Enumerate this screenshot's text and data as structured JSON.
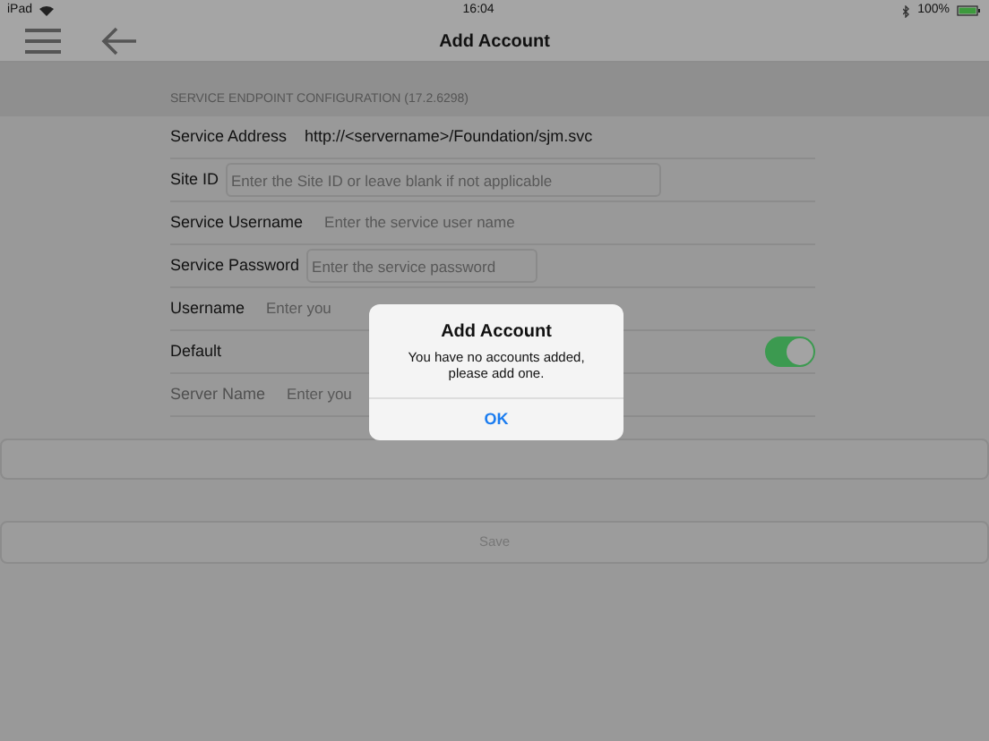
{
  "status_bar": {
    "device": "iPad",
    "time": "16:04",
    "battery": "100%"
  },
  "nav_bar": {
    "title": "Add Account"
  },
  "form": {
    "section_header": "SERVICE ENDPOINT CONFIGURATION (17.2.6298)",
    "rows": [
      {
        "kind": "value",
        "label": "Service Address",
        "value": "http://<servername>/Foundation/sjm.svc",
        "disabled": false
      },
      {
        "kind": "boxed",
        "label": "Site ID",
        "placeholder": "Enter the Site ID or leave blank if not applicable",
        "disabled": false
      },
      {
        "kind": "plain",
        "label": "Service Username",
        "placeholder": "Enter the service user name",
        "disabled": false
      },
      {
        "kind": "boxed",
        "label": "Service Password",
        "placeholder": "Enter the service password",
        "disabled": false
      },
      {
        "kind": "plain",
        "label": "Username",
        "placeholder": "Enter you",
        "disabled": false
      },
      {
        "kind": "toggle",
        "label": "Default",
        "on": true,
        "disabled": false
      },
      {
        "kind": "plain",
        "label": "Server Name",
        "placeholder": "Enter you",
        "disabled": true
      }
    ]
  },
  "save_button": {
    "label": "Save",
    "disabled": true
  },
  "alert": {
    "title": "Add Account",
    "message": "You have no accounts added, please add one.",
    "button": "OK"
  }
}
